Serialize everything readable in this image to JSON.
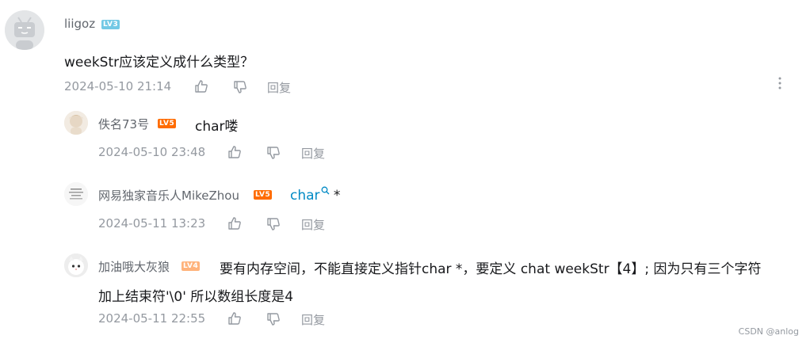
{
  "comment": {
    "username": "liigoz",
    "level": "LV3",
    "text": "weekStr应该定义成什么类型？",
    "time": "2024-05-10 21:14",
    "reply_label": "回复"
  },
  "replies": [
    {
      "username": "佚名73号",
      "level": "LV5",
      "text": "char喽",
      "time": "2024-05-10 23:48",
      "reply_label": "回复"
    },
    {
      "username": "网易独家音乐人MikeZhou",
      "level": "LV5",
      "link_text": "char",
      "text_after": " *",
      "time": "2024-05-11 13:23",
      "reply_label": "回复"
    },
    {
      "username": "加油哦大灰狼",
      "level": "LV4",
      "text_line1": "要有内存空间，不能直接定义指针char *，要定义 chat weekStr【4】; 因为只有三个字符",
      "text_line2": "加上结束符'\\0' 所以数组长度是4",
      "time": "2024-05-11 22:55",
      "reply_label": "回复"
    }
  ],
  "watermark": "CSDN @anlog",
  "colors": {
    "lv3": "#73c9e5",
    "lv4": "#ffb37c",
    "lv5": "#ff6c00",
    "link": "#008ac5"
  },
  "icons": [
    "like-icon",
    "dislike-icon",
    "more-icon",
    "search-icon"
  ]
}
